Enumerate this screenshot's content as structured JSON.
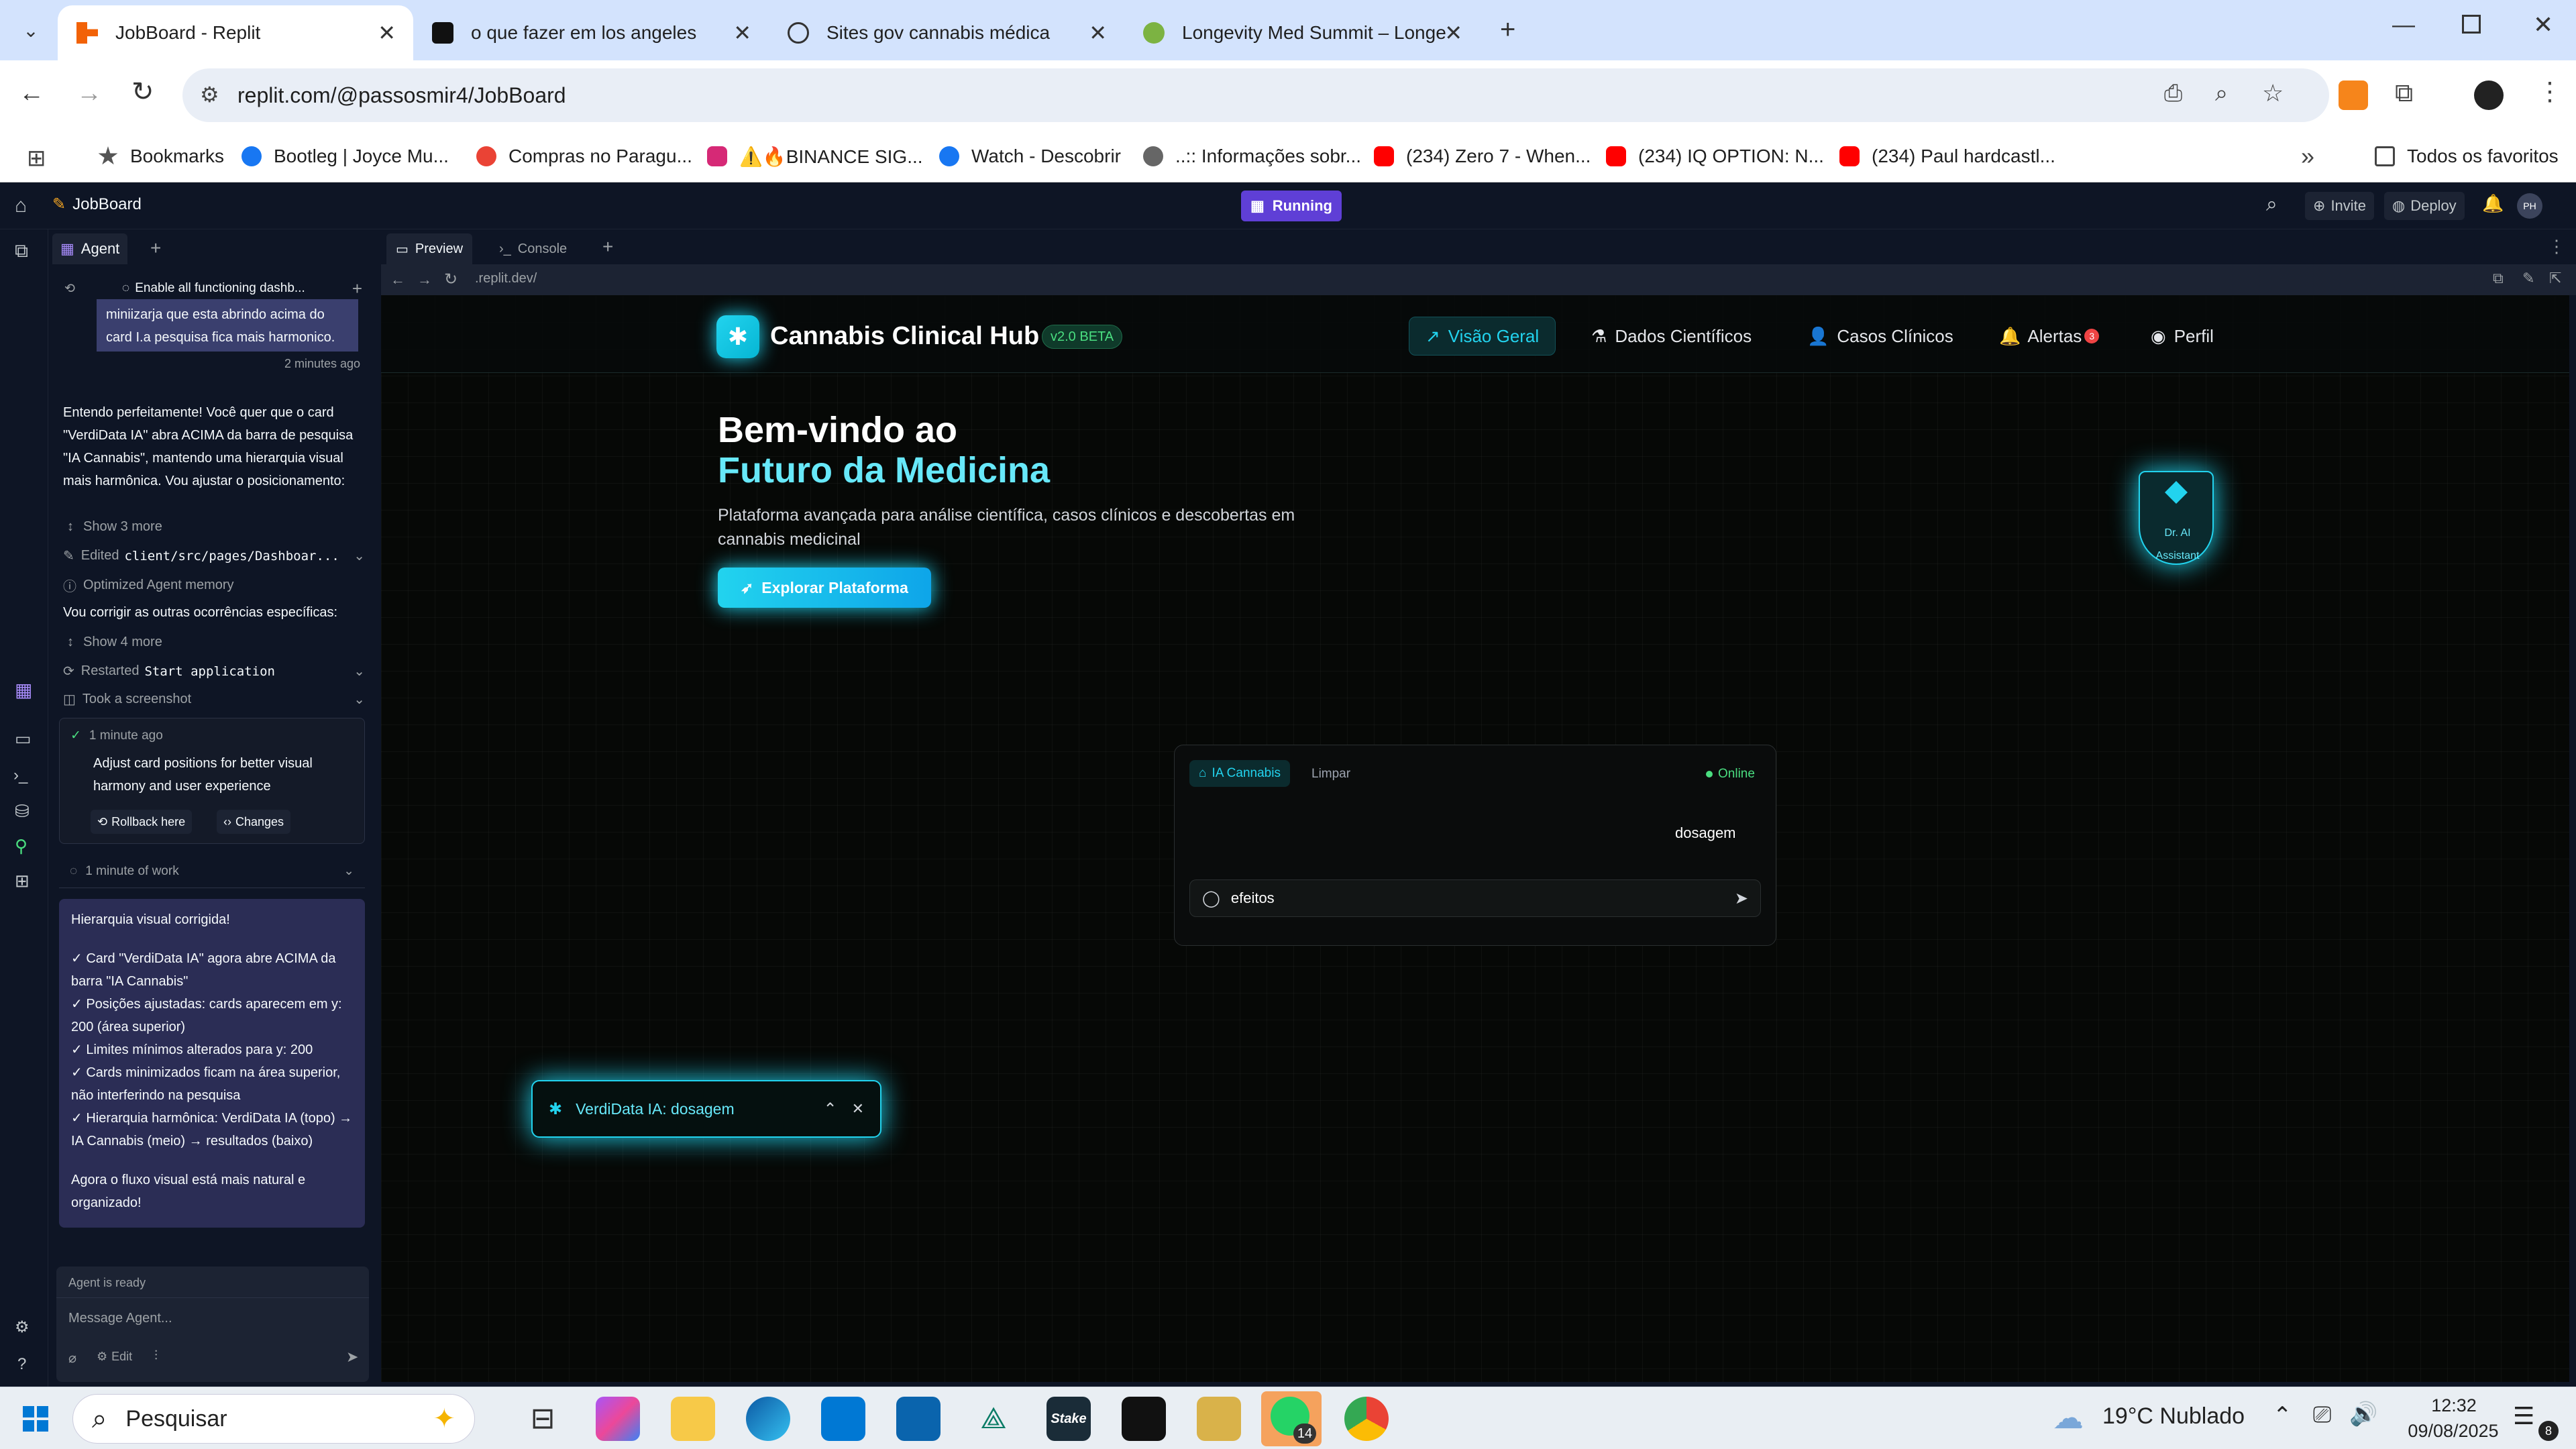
{
  "browser": {
    "tabs": [
      {
        "title": "JobBoard - Replit"
      },
      {
        "title": "o que fazer em los angeles"
      },
      {
        "title": "Sites gov cannabis médica"
      },
      {
        "title": "Longevity Med Summit – Longe"
      }
    ],
    "url": "replit.com/@passosmir4/JobBoard",
    "bookmarks": [
      "Bookmarks",
      "Bootleg | Joyce Mu...",
      "Compras no Paragu...",
      "⚠️🔥BINANCE SIG...",
      "Watch - Descobrir",
      "..:: Informações sobr...",
      "(234) Zero 7 - When...",
      "(234) IQ OPTION: N...",
      "(234) Paul hardcastl..."
    ],
    "all_bookmarks": "Todos os favoritos"
  },
  "replit": {
    "project": "JobBoard",
    "status": "Running",
    "invite": "Invite",
    "deploy": "Deploy",
    "avatar": "PH",
    "agent_tab": "Agent",
    "preview_tab": "Preview",
    "console_tab": "Console",
    "address": ".replit.dev/",
    "agent": {
      "thread_title": "Enable all functioning dashb...",
      "user_msg": "miniizarja que esta abrindo acima do card I.a pesquisa fica mais harmonico.",
      "user_time": "2 minutes ago",
      "reply": "Entendo perfeitamente! Você quer que o card \"VerdiData IA\" abra ACIMA da barra de pesquisa \"IA Cannabis\", mantendo uma hierarquia visual mais harmônica. Vou ajustar o posicionamento:",
      "show3": "Show 3 more",
      "edited": "Edited",
      "edited_file": "client/src/pages/Dashboar...",
      "memory": "Optimized Agent memory",
      "fix_text": "Vou corrigir as outras ocorrências específicas:",
      "show4": "Show 4 more",
      "restarted": "Restarted",
      "restarted_cmd": "Start application",
      "screenshot": "Took a screenshot",
      "checkpoint_time": "1 minute ago",
      "checkpoint_text": "Adjust card positions for better visual harmony and user experience",
      "rollback": "Rollback here",
      "changes": "Changes",
      "work": "1 minute of work",
      "summary": [
        "Hierarquia visual corrigida!",
        "✓ Card \"VerdiData IA\" agora abre ACIMA da barra \"IA Cannabis\"",
        "✓ Posições ajustadas: cards aparecem em y: 200 (área superior)",
        "✓ Limites mínimos alterados para y: 200",
        "✓ Cards minimizados ficam na área superior, não interferindo na pesquisa",
        "✓ Hierarquia harmônica: VerdiData IA (topo) → IA Cannabis (meio) → resultados (baixo)",
        "Agora o fluxo visual está mais natural e organizado!"
      ],
      "ready": "Agent is ready",
      "placeholder": "Message Agent...",
      "edit": "Edit"
    }
  },
  "app": {
    "brand": "Cannabis Clinical Hub",
    "version": "v2.0 BETA",
    "nav": [
      {
        "label": "Visão Geral",
        "icon": "chart-line-icon"
      },
      {
        "label": "Dados Científicos",
        "icon": "flask-icon"
      },
      {
        "label": "Casos Clínicos",
        "icon": "user-icon"
      },
      {
        "label": "Alertas",
        "icon": "bell-icon",
        "badge": "3"
      },
      {
        "label": "Perfil",
        "icon": "user-circle-icon"
      }
    ],
    "hero_title_1": "Bem-vindo ao",
    "hero_title_2": "Futuro da Medicina",
    "hero_sub": "Plataforma avançada para análise científica, casos clínicos e descobertas em cannabis medicinal",
    "cta": "Explorar Plataforma",
    "assistant_label": "Dr. AI Assistant",
    "search": {
      "tag": "IA Cannabis",
      "clear": "Limpar",
      "status": "Online",
      "result": "dosagem",
      "value": "efeitos"
    },
    "verdidata": "VerdiData IA: dosagem",
    "accent": "#22d3ee"
  },
  "taskbar": {
    "search": "Pesquisar",
    "weather": "19°C  Nublado",
    "time": "12:32",
    "date": "09/08/2025",
    "whatsapp_badge": "14",
    "notif_badge": "8"
  }
}
